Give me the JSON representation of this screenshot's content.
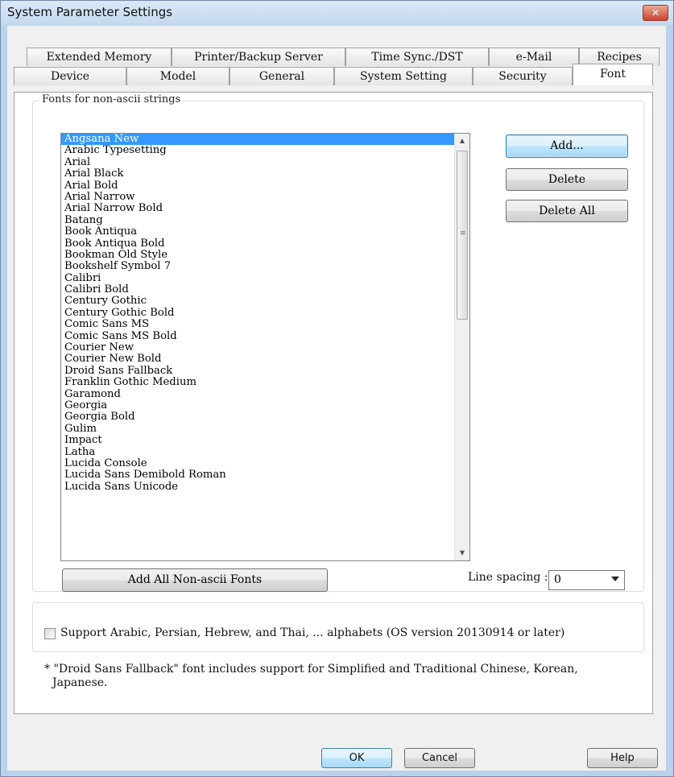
{
  "window": {
    "title": "System Parameter Settings",
    "close_label": "✕"
  },
  "tabs_row1": [
    "Extended Memory",
    "Printer/Backup Server",
    "Time Sync./DST",
    "e-Mail",
    "Recipes"
  ],
  "tabs_row2": [
    "Device",
    "Model",
    "General",
    "System Setting",
    "Security",
    "Font"
  ],
  "active_tab": "Font",
  "font_group": {
    "title": "Fonts for non-ascii strings",
    "fonts": [
      "Angsana New",
      "Arabic Typesetting",
      "Arial",
      "Arial Black",
      "Arial Bold",
      "Arial Narrow",
      "Arial Narrow Bold",
      "Batang",
      "Book Antiqua",
      "Book Antiqua Bold",
      "Bookman Old Style",
      "Bookshelf Symbol 7",
      "Calibri",
      "Calibri Bold",
      "Century Gothic",
      "Century Gothic Bold",
      "Comic Sans MS",
      "Comic Sans MS Bold",
      "Courier New",
      "Courier New Bold",
      "Droid Sans Fallback",
      "Franklin Gothic Medium",
      "Garamond",
      "Georgia",
      "Georgia Bold",
      "Gulim",
      "Impact",
      "Latha",
      "Lucida Console",
      "Lucida Sans Demibold Roman",
      "Lucida Sans Unicode"
    ],
    "selected_index": 0,
    "add_label": "Add...",
    "delete_label": "Delete",
    "delete_all_label": "Delete All",
    "add_all_label": "Add All Non-ascii Fonts",
    "line_spacing_label": "Line spacing :",
    "line_spacing_value": "0"
  },
  "support_checkbox": {
    "label": "Support Arabic, Persian, Hebrew, and Thai, ... alphabets (OS version 20130914 or later)",
    "checked": false
  },
  "note": {
    "line1": "* \"Droid Sans Fallback\" font includes support for Simplified and Traditional Chinese, Korean,",
    "line2": "Japanese."
  },
  "footer": {
    "ok_label": "OK",
    "cancel_label": "Cancel",
    "help_label": "Help"
  }
}
